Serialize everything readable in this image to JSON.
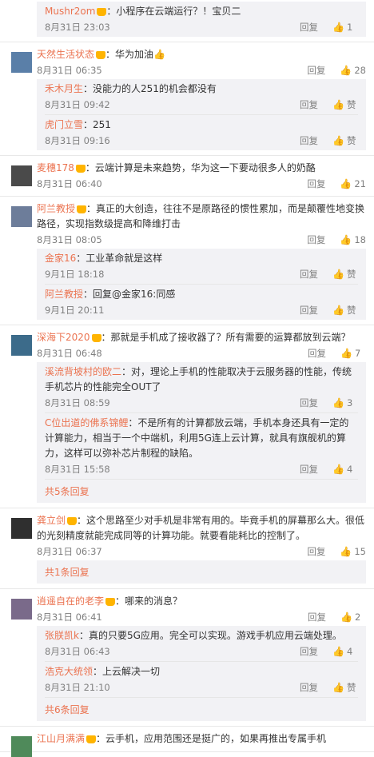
{
  "top": {
    "name": "Mushr2om",
    "text": "：小程序在云端运行？！宝贝二",
    "time": "8月31日 23:03",
    "reply": "回复",
    "likes": "1"
  },
  "comments": [
    {
      "name": "天然生活状态",
      "text": "：华为加油👍",
      "time": "8月31日 06:35",
      "reply": "回复",
      "likes": "28",
      "subs": [
        {
          "name": "禾木月生",
          "text": "：没能力的人251的机会都没有",
          "time": "8月31日 09:42",
          "reply": "回复",
          "likes": "赞"
        },
        {
          "name": "虎门立雪",
          "text": "：251",
          "time": "8月31日 09:16",
          "reply": "回复",
          "likes": "赞"
        }
      ]
    },
    {
      "name": "麦穗178",
      "text": "：云端计算是未来趋势，华为这一下要动很多人的奶酪",
      "time": "8月31日 06:40",
      "reply": "回复",
      "likes": "21",
      "subs": []
    },
    {
      "name": "阿兰教授",
      "text": "：真正的大创造，往往不是原路径的惯性累加，而是颠覆性地变换路径，实现指数级提高和降维打击",
      "time": "8月31日 08:05",
      "reply": "回复",
      "likes": "18",
      "subs": [
        {
          "name": "金家16",
          "text": "：工业革命就是这样",
          "time": "9月1日 18:18",
          "reply": "回复",
          "likes": "赞"
        },
        {
          "name": "阿兰教授",
          "text": "：回复@金家16:同感",
          "time": "9月1日 20:11",
          "reply": "回复",
          "likes": "赞"
        }
      ]
    },
    {
      "name": "深海下2020",
      "text": "：那就是手机成了接收器了？所有需要的运算都放到云端？",
      "time": "8月31日 06:48",
      "reply": "回复",
      "likes": "7",
      "subs": [
        {
          "name": "溪流背坡村的欧二",
          "text": "：对，理论上手机的性能取决于云服务器的性能，传统手机芯片的性能完全OUT了",
          "time": "8月31日 08:59",
          "reply": "回复",
          "likes": "3"
        },
        {
          "name": "C位出道的佛系锦鲤",
          "text": "：不是所有的计算都放云端，手机本身还具有一定的计算能力，相当于一个中端机，利用5G连上云计算，就具有旗舰机的算力，这样可以弥补芯片制程的缺陷。",
          "time": "8月31日 15:58",
          "reply": "回复",
          "likes": "4"
        }
      ],
      "more": "共5条回复"
    },
    {
      "name": "龚立剑",
      "text": "：这个思路至少对手机是非常有用的。毕竟手机的屏幕那么大。很低的光刻精度就能完成同等的计算功能。就要看能耗比的控制了。",
      "time": "8月31日 06:37",
      "reply": "回复",
      "likes": "15",
      "subs": [],
      "more": "共1条回复"
    },
    {
      "name": "逍遥自在的老李",
      "text": "：哪来的消息？",
      "time": "8月31日 06:41",
      "reply": "回复",
      "likes": "2",
      "subs": [
        {
          "name": "张朕凯k",
          "text": "：真的只要5G应用。完全可以实现。游戏手机应用云端处理。",
          "time": "8月31日 06:43",
          "reply": "回复",
          "likes": "4"
        },
        {
          "name": "浩克大统领",
          "text": "：上云解决一切",
          "time": "8月31日 21:10",
          "reply": "回复",
          "likes": "赞"
        }
      ],
      "more": "共6条回复"
    },
    {
      "name": "江山月满满",
      "text": "：云手机，应用范围还是挺广的，如果再推出专属手机",
      "time": "",
      "reply": "",
      "likes": "",
      "subs": []
    }
  ],
  "colors": {
    "name": "#eb7350",
    "meta": "#808080",
    "subbg": "#f2f2f5"
  }
}
